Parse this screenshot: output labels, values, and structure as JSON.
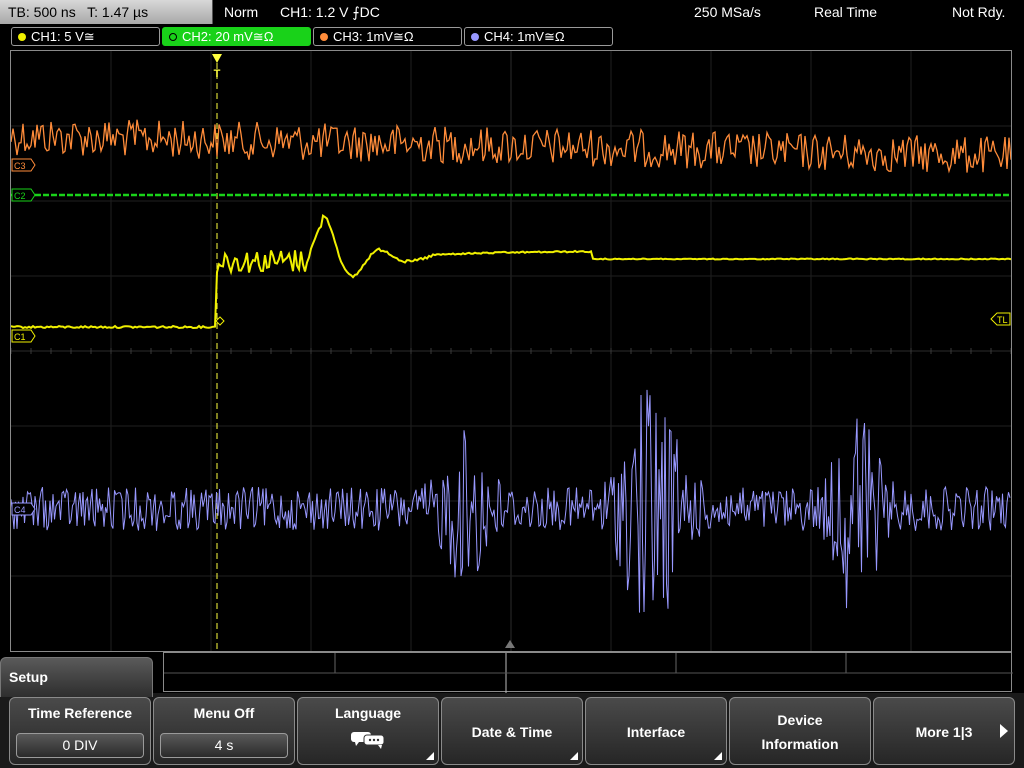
{
  "status": {
    "timebase": "TB: 500 ns",
    "trigger_time": "T: 1.47 µs",
    "mode": "Norm",
    "trigger_setting": "CH1: 1.2 V ⨍DC",
    "sample_rate": "250 MSa/s",
    "acq_mode": "Real Time",
    "ready": "Not Rdy."
  },
  "channels": [
    {
      "label": "CH1: 5 V≅",
      "color": "#f0f000",
      "active": false
    },
    {
      "label": "CH2: 20 mV≅Ω",
      "color": "#19d219",
      "active": true
    },
    {
      "label": "CH3: 1mV≅Ω",
      "color": "#ff8c3a",
      "active": false
    },
    {
      "label": "CH4: 1mV≅Ω",
      "color": "#9898ff",
      "active": false
    }
  ],
  "markers": {
    "c3": "C3",
    "c2": "C2",
    "c1": "C1",
    "c4": "C4",
    "trigger_level": "TL",
    "trigger_pos": "T"
  },
  "menu": {
    "title": "Setup",
    "softkeys": [
      {
        "label": "Time Reference",
        "value": "0 DIV"
      },
      {
        "label": "Menu Off",
        "value": "4 s"
      },
      {
        "label": "Language",
        "icon": "speech-bubbles-icon"
      },
      {
        "label": "Date & Time"
      },
      {
        "label": "Interface"
      },
      {
        "label_line1": "Device",
        "label_line2": "Information"
      },
      {
        "label": "More 1|3"
      }
    ]
  }
}
